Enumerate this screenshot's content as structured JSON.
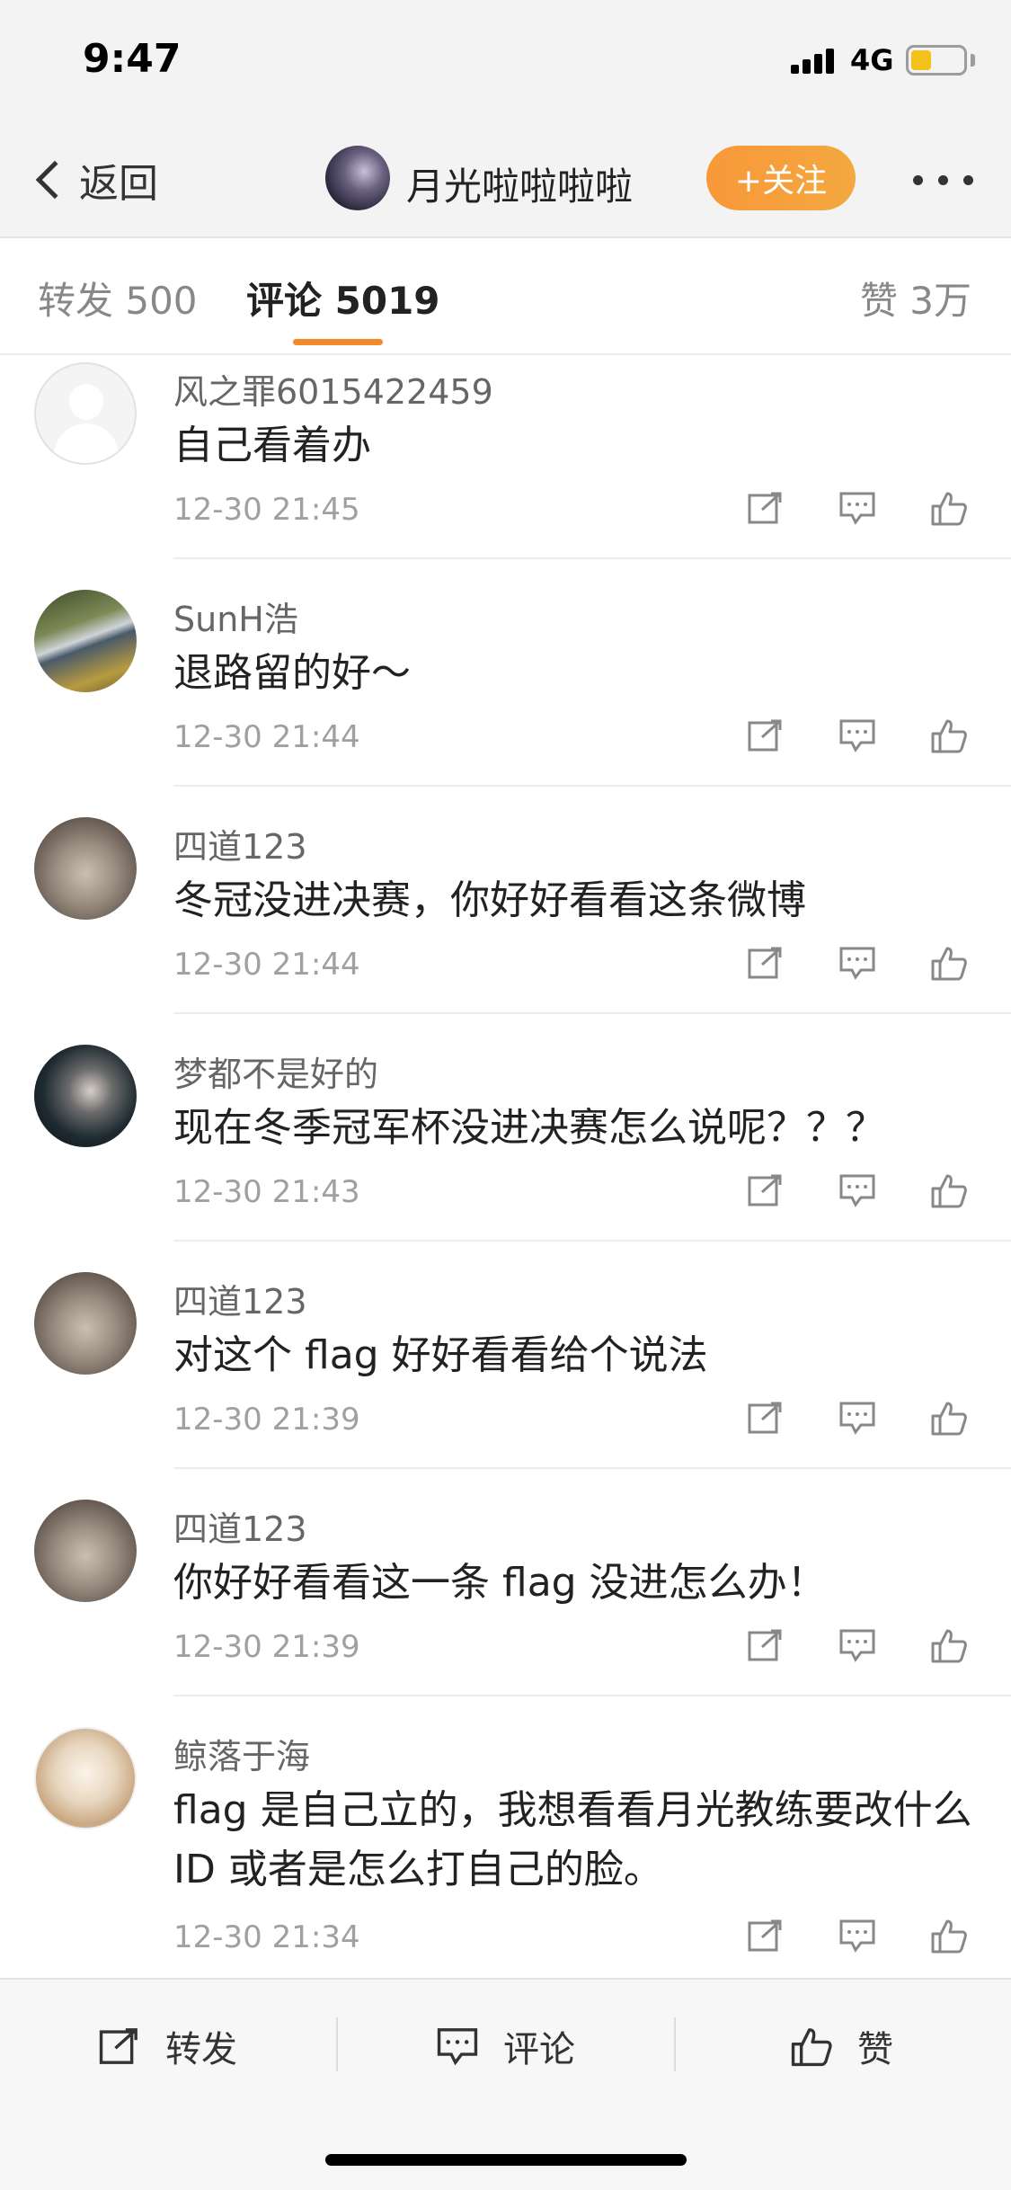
{
  "status_bar": {
    "time": "9:47",
    "network": "4G",
    "battery_color": "#f2c21b"
  },
  "nav": {
    "back_label": "返回",
    "title": "月光啦啦啦啦",
    "follow_label": "+关注",
    "accent": "#f8983a"
  },
  "tabs": {
    "repost": "转发 500",
    "comment": "评论 5019",
    "likes": "赞 3万",
    "active": "comment"
  },
  "comments": [
    {
      "name": "风之罪6015422459",
      "text": "自己看着办",
      "time": "12-30 21:45",
      "avatar": "default-avatar"
    },
    {
      "name": "SunH浩",
      "text": "退路留的好～",
      "time": "12-30 21:44",
      "avatar": "street-photo-avatar"
    },
    {
      "name": "四道123",
      "text": "冬冠没进决赛，你好好看看这条微博",
      "time": "12-30 21:44",
      "avatar": "cat-avatar"
    },
    {
      "name": "梦都不是好的",
      "text": "现在冬季冠军杯没进决赛怎么说呢？？？",
      "time": "12-30 21:43",
      "avatar": "person-avatar"
    },
    {
      "name": "四道123",
      "text": "对这个 flag 好好看看给个说法",
      "time": "12-30 21:39",
      "avatar": "cat-avatar"
    },
    {
      "name": "四道123",
      "text": "你好好看看这一条 flag 没进怎么办！",
      "time": "12-30 21:39",
      "avatar": "cat-avatar"
    },
    {
      "name": "鲸落于海",
      "text": "flag 是自己立的，我想看看月光教练要改什么 ID 或者是怎么打自己的脸。",
      "time": "12-30 21:34",
      "avatar": "anime-avatar"
    }
  ],
  "bottom_bar": {
    "repost": "转发",
    "comment": "评论",
    "like": "赞"
  }
}
